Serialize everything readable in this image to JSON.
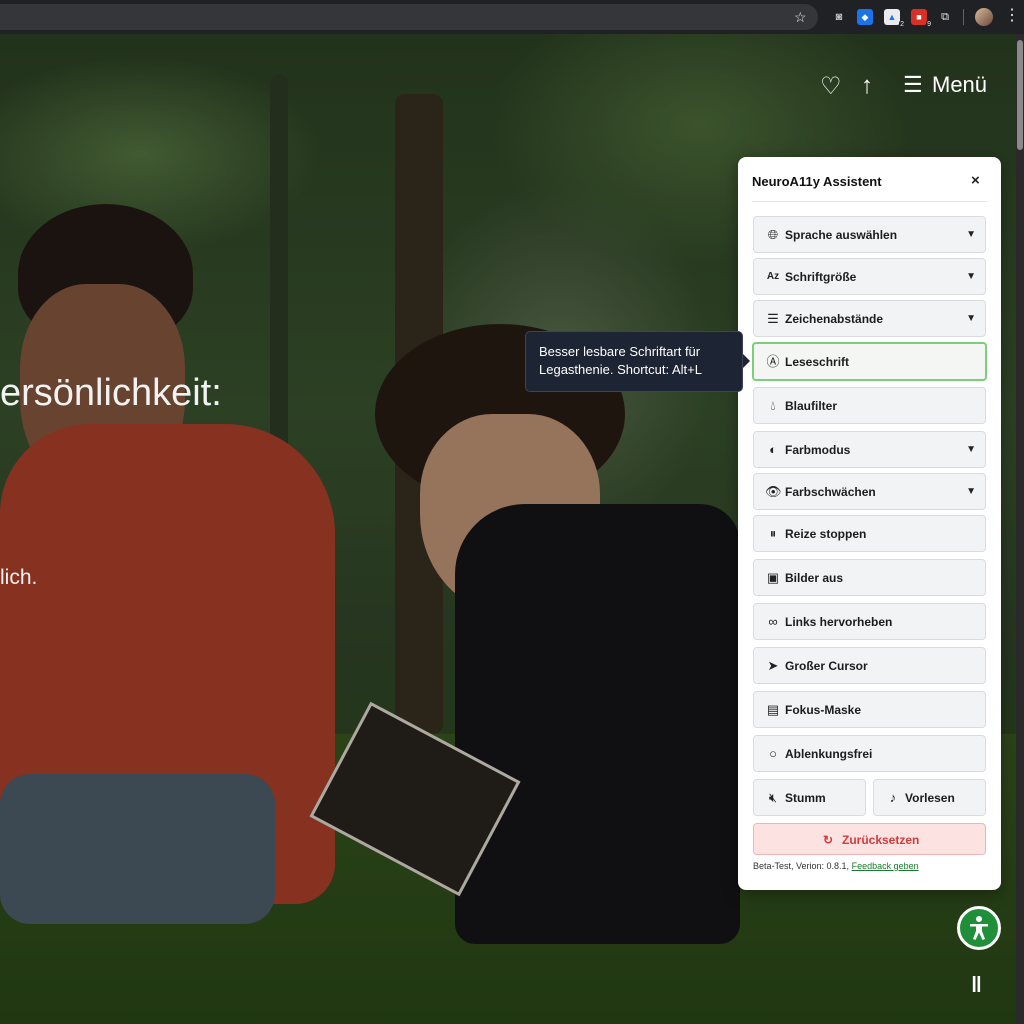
{
  "hero": {
    "headline_fragment": "ersönlichkeit:",
    "body_fragment": "lich.",
    "nav": {
      "menu_label": "Menü"
    }
  },
  "panel": {
    "title": "NeuroA11y Assistent",
    "close_symbol": "×",
    "items": [
      {
        "label": "Sprache auswählen",
        "icon": "globe-icon",
        "has_dropdown": true
      },
      {
        "label": "Schriftgröße",
        "icon": "font-size-icon",
        "has_dropdown": true
      },
      {
        "label": "Zeichenabstände",
        "icon": "spacing-icon",
        "has_dropdown": true
      },
      {
        "label": "Leseschrift",
        "icon": "reading-font-icon",
        "has_dropdown": false,
        "focused": true
      },
      {
        "label": "Blaufilter",
        "icon": "drop-icon",
        "has_dropdown": false
      },
      {
        "label": "Farbmodus",
        "icon": "contrast-icon",
        "has_dropdown": true
      },
      {
        "label": "Farbschwächen",
        "icon": "eye-icon",
        "has_dropdown": true
      },
      {
        "label": "Reize stoppen",
        "icon": "pause-circle-icon",
        "has_dropdown": false
      },
      {
        "label": "Bilder aus",
        "icon": "image-icon",
        "has_dropdown": false
      },
      {
        "label": "Links hervorheben",
        "icon": "link-icon",
        "has_dropdown": false
      },
      {
        "label": "Großer Cursor",
        "icon": "cursor-icon",
        "has_dropdown": false
      },
      {
        "label": "Fokus-Maske",
        "icon": "mask-icon",
        "has_dropdown": false
      },
      {
        "label": "Ablenkungsfrei",
        "icon": "circle-icon",
        "has_dropdown": false
      }
    ],
    "mute_label": "Stumm",
    "read_aloud_label": "Vorlesen",
    "reset_label": "Zurücksetzen",
    "footer_text": "Beta-Test, Verion: 0.8.1,",
    "feedback_link": "Feedback geben"
  },
  "tooltip": {
    "text": "Besser lesbare Schriftart für Legasthenie. Shortcut: Alt+L"
  },
  "colors": {
    "accent_green": "#1f8f3a",
    "focus_border": "#7ccf7a",
    "reset_red": "#d23b3b",
    "tooltip_bg": "#1d2433"
  }
}
